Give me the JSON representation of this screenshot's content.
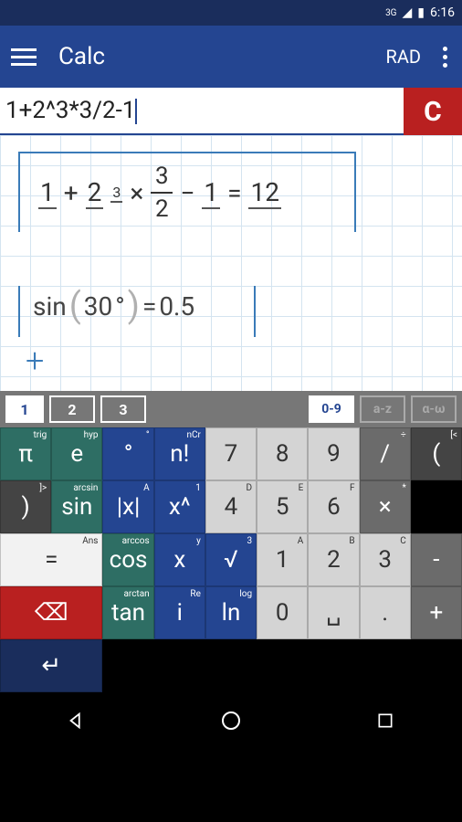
{
  "status": {
    "network": "3G",
    "time": "6:16"
  },
  "app": {
    "title": "Calc",
    "angle_mode": "RAD"
  },
  "input": {
    "expression": "1+2^3*3/2-1",
    "clear_label": "C"
  },
  "workspace": {
    "expr1": {
      "t1": "1",
      "op1": "+",
      "t2": "2",
      "exp": "3",
      "op2": "×",
      "fn": "3",
      "fd": "2",
      "op3": "−",
      "t3": "1",
      "eq": "=",
      "res": "12"
    },
    "expr2": {
      "fn": "sin",
      "arg": "30",
      "deg": "°",
      "eq": "=",
      "res": "0.5"
    },
    "add": "+"
  },
  "tabs": {
    "workspace": [
      "1",
      "2",
      "3"
    ],
    "modes": [
      "0-9",
      "a-z",
      "α-ω"
    ]
  },
  "keys": [
    [
      {
        "l": "π",
        "s": "trig",
        "c": "teal"
      },
      {
        "l": "e",
        "s": "hyp",
        "c": "teal"
      },
      {
        "l": "°",
        "s": "°",
        "c": "blue"
      },
      {
        "l": "n!",
        "s": "nCr",
        "c": "blue"
      },
      {
        "l": "7",
        "s": "",
        "c": "ltgray"
      },
      {
        "l": "8",
        "s": "",
        "c": "ltgray"
      },
      {
        "l": "9",
        "s": "",
        "c": "ltgray"
      },
      {
        "l": "/",
        "s": "÷",
        "c": "gray"
      },
      {
        "l": "(",
        "s": "[<",
        "c": "dkgray"
      }
    ],
    [
      {
        "l": ")",
        "s": "]>",
        "c": "dkgray"
      }
    ],
    [
      {
        "l": "sin",
        "s": "arcsin",
        "c": "teal"
      },
      {
        "l": "|x|",
        "s": "A",
        "c": "blue"
      },
      {
        "l": "x^",
        "s": "1",
        "c": "blue"
      },
      {
        "l": "4",
        "s": "D",
        "c": "ltgray"
      },
      {
        "l": "5",
        "s": "E",
        "c": "ltgray"
      },
      {
        "l": "6",
        "s": "F",
        "c": "ltgray"
      },
      {
        "l": "×",
        "s": "*",
        "c": "gray"
      },
      {
        "l": "=",
        "s": "Ans",
        "c": "white",
        "span": 2
      }
    ],
    [
      {
        "l": "cos",
        "s": "arccos",
        "c": "teal"
      },
      {
        "l": "x",
        "s": "y",
        "c": "blue"
      },
      {
        "l": "√",
        "s": "3",
        "c": "blue"
      },
      {
        "l": "1",
        "s": "A",
        "c": "ltgray"
      },
      {
        "l": "2",
        "s": "B",
        "c": "ltgray"
      },
      {
        "l": "3",
        "s": "C",
        "c": "ltgray"
      },
      {
        "l": "-",
        "s": "",
        "c": "gray"
      },
      {
        "l": "⌫",
        "s": "",
        "c": "red",
        "span": 2
      }
    ],
    [
      {
        "l": "tan",
        "s": "arctan",
        "c": "teal"
      },
      {
        "l": "i",
        "s": "Re",
        "c": "blue"
      },
      {
        "l": "ln",
        "s": "log",
        "c": "blue"
      },
      {
        "l": "0",
        "s": "",
        "c": "ltgray"
      },
      {
        "l": "␣",
        "s": "",
        "c": "ltgray"
      },
      {
        "l": ".",
        "s": "",
        "c": "ltgray"
      },
      {
        "l": "+",
        "s": "",
        "c": "gray"
      },
      {
        "l": "↵",
        "s": "",
        "c": "navy",
        "span": 2
      }
    ]
  ]
}
